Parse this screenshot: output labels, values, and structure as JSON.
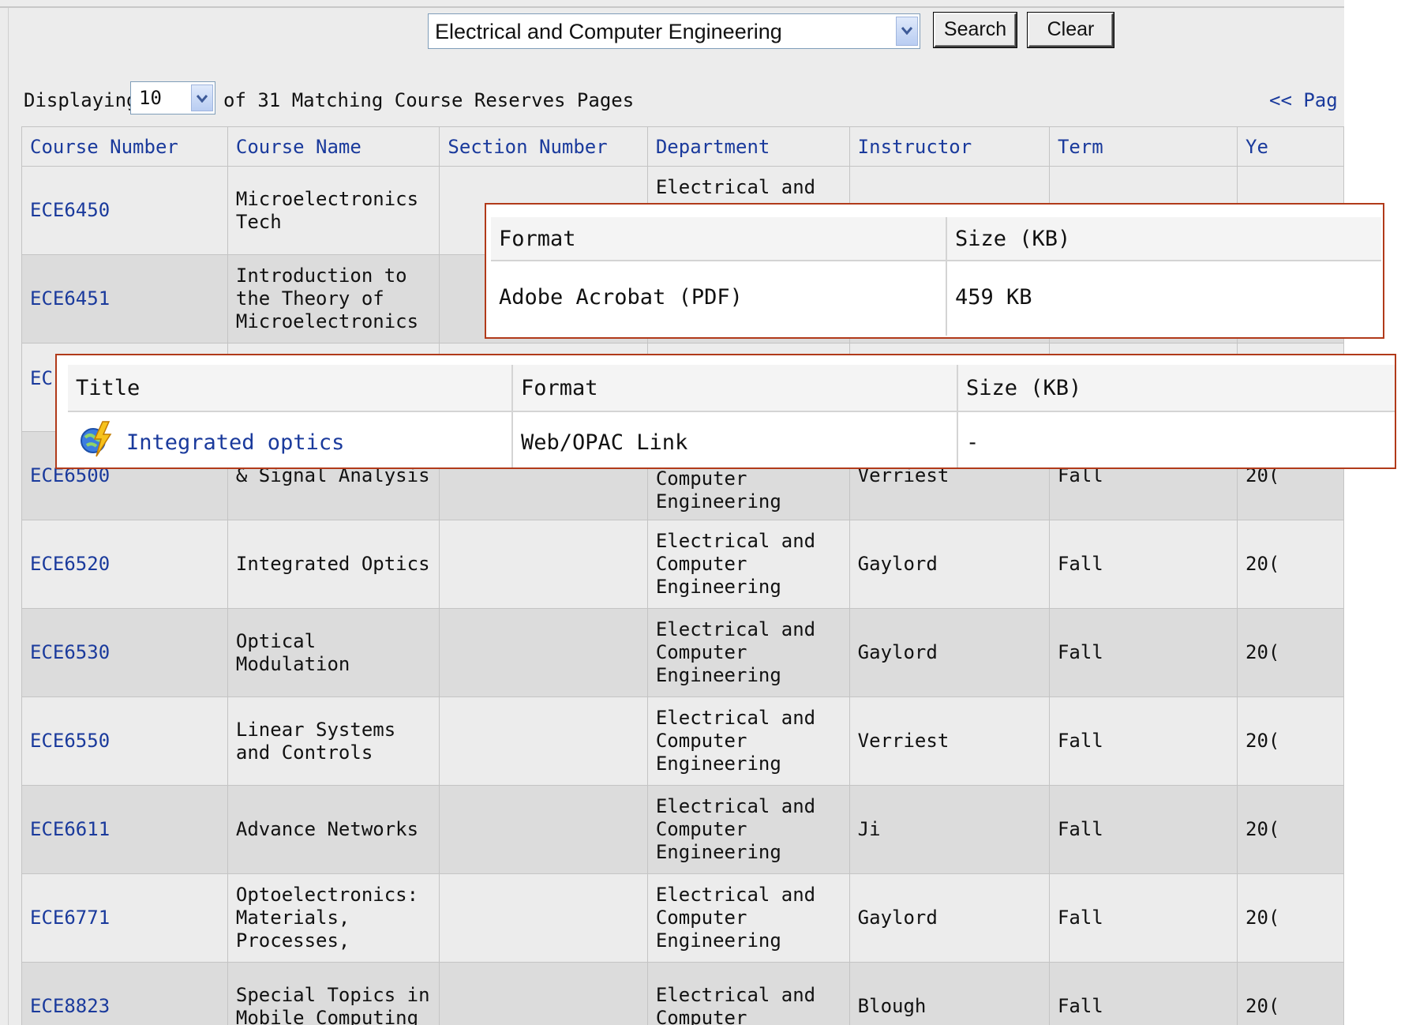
{
  "search": {
    "department_value": "Electrical and Computer Engineering",
    "search_label": "Search",
    "clear_label": "Clear"
  },
  "display": {
    "prefix": "Displaying",
    "count_value": "10",
    "suffix": "of 31 Matching Course Reserves Pages",
    "pager_label": "<< Pag"
  },
  "table": {
    "headers": [
      "Course Number",
      "Course Name",
      "Section Number",
      "Department",
      "Instructor",
      "Term",
      "Ye"
    ],
    "rows": [
      {
        "course_number": "ECE6450",
        "course_name": "Microelectronics Tech",
        "section": "",
        "department": "Electrical and",
        "instructor": "",
        "term": "",
        "year": ""
      },
      {
        "course_number": "ECE6451",
        "course_name": "Introduction to the Theory of Microelectronics",
        "section": "",
        "department": "",
        "instructor": "",
        "term": "",
        "year": ""
      },
      {
        "course_number": "EC",
        "course_name": "",
        "section": "",
        "department": "",
        "instructor": "",
        "term": "",
        "year": ""
      },
      {
        "course_number": "ECE6500",
        "course_name": "& Signal Analysis",
        "section": "",
        "department": "Computer Engineering",
        "instructor": "Verriest",
        "term": "Fall",
        "year": "20("
      },
      {
        "course_number": "ECE6520",
        "course_name": "Integrated Optics",
        "section": "",
        "department": "Electrical and Computer Engineering",
        "instructor": "Gaylord",
        "term": "Fall",
        "year": "20("
      },
      {
        "course_number": "ECE6530",
        "course_name": "Optical Modulation",
        "section": "",
        "department": "Electrical and Computer Engineering",
        "instructor": "Gaylord",
        "term": "Fall",
        "year": "20("
      },
      {
        "course_number": "ECE6550",
        "course_name": "Linear Systems and Controls",
        "section": "",
        "department": "Electrical and Computer Engineering",
        "instructor": "Verriest",
        "term": "Fall",
        "year": "20("
      },
      {
        "course_number": "ECE6611",
        "course_name": "Advance Networks",
        "section": "",
        "department": "Electrical and Computer Engineering",
        "instructor": "Ji",
        "term": "Fall",
        "year": "20("
      },
      {
        "course_number": "ECE6771",
        "course_name": "Optoelectronics: Materials, Processes,",
        "section": "",
        "department": "Electrical and Computer Engineering",
        "instructor": "Gaylord",
        "term": "Fall",
        "year": "20("
      },
      {
        "course_number": "ECE8823",
        "course_name": "Special Topics in Mobile Computing",
        "section": "",
        "department": "Electrical and Computer",
        "instructor": "Blough",
        "term": "Fall",
        "year": "20("
      }
    ]
  },
  "popup_file": {
    "format_header": "Format",
    "size_header": "Size (KB)",
    "format_value": "Adobe Acrobat (PDF)",
    "size_value": "459 KB"
  },
  "popup_link": {
    "title_header": "Title",
    "format_header": "Format",
    "size_header": "Size (KB)",
    "title_value": "Integrated optics",
    "format_value": "Web/OPAC Link",
    "size_value": "-",
    "icon": "web-link-icon"
  },
  "colors": {
    "link": "#1a3a9c",
    "popup_border": "#b13a1a",
    "row_light": "#ececec",
    "row_dark": "#dcdcdc"
  }
}
